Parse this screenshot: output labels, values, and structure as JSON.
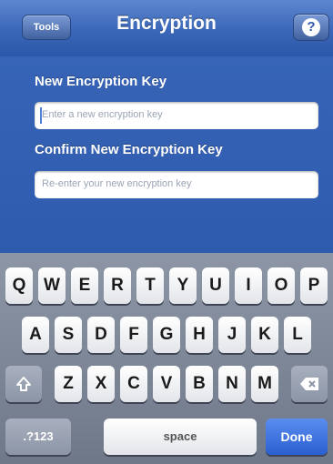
{
  "navbar": {
    "left_button": "Tools",
    "title": "Encryption",
    "help_glyph": "?"
  },
  "form": {
    "new_key_label": "New Encryption Key",
    "new_key_placeholder": "Enter a new encryption key",
    "confirm_key_label": "Confirm New Encryption Key",
    "confirm_key_placeholder": "Re-enter your new encryption key"
  },
  "keyboard": {
    "row1": [
      "Q",
      "W",
      "E",
      "R",
      "T",
      "Y",
      "U",
      "I",
      "O",
      "P"
    ],
    "row2": [
      "A",
      "S",
      "D",
      "F",
      "G",
      "H",
      "J",
      "K",
      "L"
    ],
    "row3": [
      "Z",
      "X",
      "C",
      "V",
      "B",
      "N",
      "M"
    ],
    "shift_icon": "shift-arrow-icon",
    "backspace_icon": "backspace-icon",
    "numbers_label": ".?123",
    "space_label": "space",
    "done_label": "Done"
  },
  "colors": {
    "background": "#2f5cb0",
    "done": "#2a5fd0"
  }
}
